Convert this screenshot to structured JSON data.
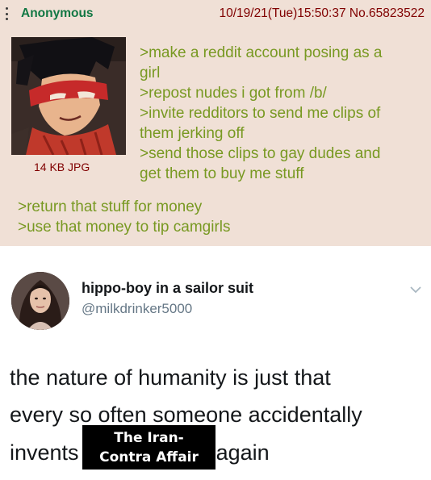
{
  "post": {
    "name": "Anonymous",
    "meta": "10/19/21(Tue)15:50:37 No.65823522",
    "file_info": "14 KB JPG",
    "lines_right": [
      ">make a reddit account posing as a",
      "girl",
      ">repost nudes i got from /b/",
      ">invite redditors to send me clips of",
      "them jerking off",
      ">send those clips to gay dudes and",
      "get them to buy me stuff"
    ],
    "lines_left": [
      ">return that stuff for money",
      ">use that money to tip camgirls"
    ],
    "colors": {
      "background": "#f0e0d6",
      "name": "#117743",
      "meta": "#800000",
      "greentext": "#789922"
    }
  },
  "tweet": {
    "display_name": "hippo-boy in a sailor suit",
    "handle": "@milkdrinker5000",
    "text_line1": "the nature of humanity is just that",
    "text_line2": "every so often someone accidentally",
    "text_line3_start": "invents",
    "text_line3_end": "again",
    "caption_line1": "The Iran-",
    "caption_line2": "Contra Affair",
    "icons": [
      "avatar-photo",
      "chevron-down-icon"
    ]
  }
}
